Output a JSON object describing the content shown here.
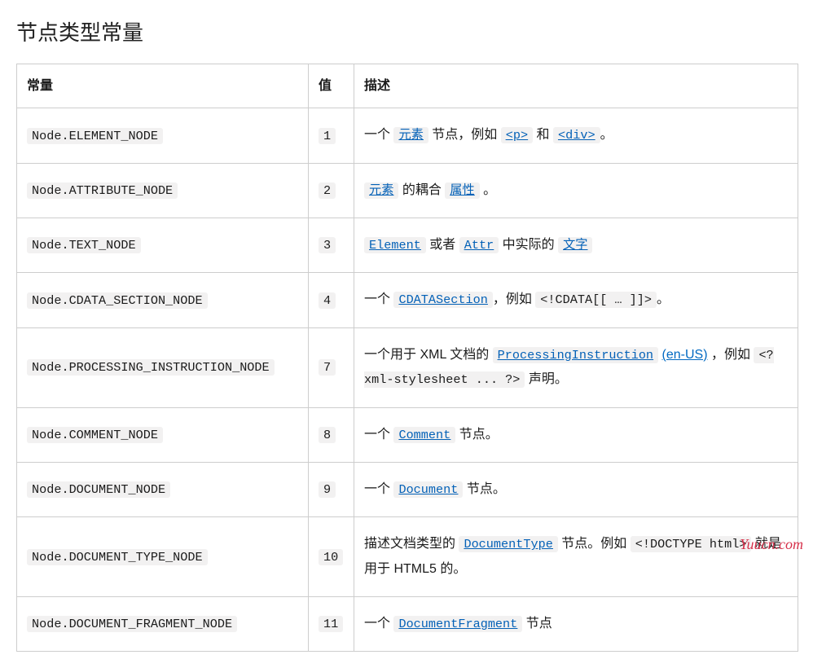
{
  "title": "节点类型常量",
  "headers": {
    "constant": "常量",
    "value": "值",
    "description": "描述"
  },
  "watermark": "Yuucn.com",
  "rows": [
    {
      "constant": "Node.ELEMENT_NODE",
      "value": "1",
      "desc": [
        {
          "t": "text",
          "v": "一个 "
        },
        {
          "t": "linkcode",
          "v": "元素"
        },
        {
          "t": "text",
          "v": " 节点，例如 "
        },
        {
          "t": "linkcode",
          "v": "<p>"
        },
        {
          "t": "text",
          "v": " 和 "
        },
        {
          "t": "linkcode",
          "v": "<div>"
        },
        {
          "t": "text",
          "v": "。"
        }
      ]
    },
    {
      "constant": "Node.ATTRIBUTE_NODE",
      "value": "2",
      "desc": [
        {
          "t": "linkcode",
          "v": "元素"
        },
        {
          "t": "text",
          "v": " 的耦合 "
        },
        {
          "t": "linkcode",
          "v": "属性"
        },
        {
          "t": "text",
          "v": " 。"
        }
      ]
    },
    {
      "constant": "Node.TEXT_NODE",
      "value": "3",
      "desc": [
        {
          "t": "linkcode",
          "v": "Element"
        },
        {
          "t": "text",
          "v": " 或者 "
        },
        {
          "t": "linkcode",
          "v": "Attr"
        },
        {
          "t": "text",
          "v": " 中实际的 "
        },
        {
          "t": "linkcode",
          "v": "文字"
        }
      ]
    },
    {
      "constant": "Node.CDATA_SECTION_NODE",
      "value": "4",
      "desc": [
        {
          "t": "text",
          "v": "一个 "
        },
        {
          "t": "linkcode",
          "v": "CDATASection"
        },
        {
          "t": "text",
          "v": "，例如 "
        },
        {
          "t": "code",
          "v": "<!CDATA[[ … ]]>"
        },
        {
          "t": "text",
          "v": "。"
        }
      ]
    },
    {
      "constant": "Node.PROCESSING_INSTRUCTION_NODE",
      "value": "7",
      "desc": [
        {
          "t": "text",
          "v": "一个用于 XML 文档的 "
        },
        {
          "t": "linkcode",
          "v": "ProcessingInstruction"
        },
        {
          "t": "text",
          "v": " "
        },
        {
          "t": "link",
          "v": "(en-US)"
        },
        {
          "t": "text",
          "v": " ，例如 "
        },
        {
          "t": "code",
          "v": "<?xml-stylesheet ... ?>"
        },
        {
          "t": "text",
          "v": " 声明。"
        }
      ]
    },
    {
      "constant": "Node.COMMENT_NODE",
      "value": "8",
      "desc": [
        {
          "t": "text",
          "v": "一个 "
        },
        {
          "t": "linkcode",
          "v": "Comment"
        },
        {
          "t": "text",
          "v": " 节点。"
        }
      ]
    },
    {
      "constant": "Node.DOCUMENT_NODE",
      "value": "9",
      "desc": [
        {
          "t": "text",
          "v": "一个 "
        },
        {
          "t": "linkcode",
          "v": "Document"
        },
        {
          "t": "text",
          "v": " 节点。"
        }
      ]
    },
    {
      "constant": "Node.DOCUMENT_TYPE_NODE",
      "value": "10",
      "desc": [
        {
          "t": "text",
          "v": "描述文档类型的 "
        },
        {
          "t": "linkcode",
          "v": "DocumentType"
        },
        {
          "t": "text",
          "v": " 节点。例如 "
        },
        {
          "t": "code",
          "v": "<!DOCTYPE html>"
        },
        {
          "t": "text",
          "v": " 就是用于 HTML5 的。"
        }
      ]
    },
    {
      "constant": "Node.DOCUMENT_FRAGMENT_NODE",
      "value": "11",
      "desc": [
        {
          "t": "text",
          "v": "一个 "
        },
        {
          "t": "linkcode",
          "v": "DocumentFragment"
        },
        {
          "t": "text",
          "v": " 节点"
        }
      ]
    }
  ]
}
